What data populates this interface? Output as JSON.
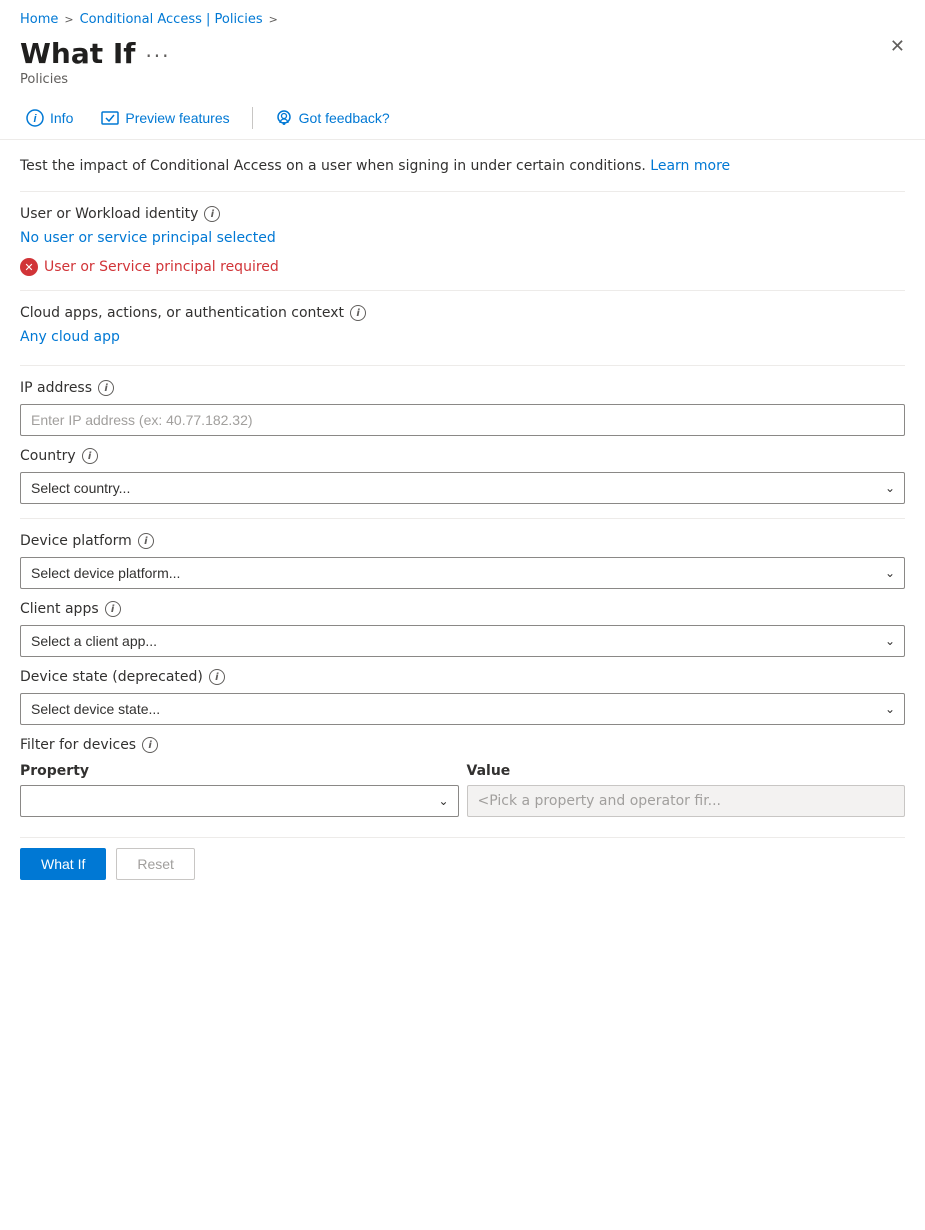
{
  "breadcrumb": {
    "home": "Home",
    "sep1": ">",
    "conditional_access": "Conditional Access | Policies",
    "sep2": ">"
  },
  "header": {
    "title": "What If",
    "more_options_label": "···",
    "subtitle": "Policies",
    "close_label": "✕"
  },
  "toolbar": {
    "info_label": "Info",
    "preview_features_label": "Preview features",
    "feedback_label": "Got feedback?"
  },
  "description": {
    "text": "Test the impact of Conditional Access on a user when signing in under certain conditions.",
    "learn_more": "Learn more"
  },
  "user_identity_section": {
    "label": "User or Workload identity",
    "no_selection_text": "No user or service principal selected",
    "error_text": "User or Service principal required"
  },
  "cloud_apps_section": {
    "label": "Cloud apps, actions, or authentication context",
    "value": "Any cloud app"
  },
  "ip_address_section": {
    "label": "IP address",
    "placeholder": "Enter IP address (ex: 40.77.182.32)"
  },
  "country_section": {
    "label": "Country",
    "placeholder": "Select country..."
  },
  "device_platform_section": {
    "label": "Device platform",
    "placeholder": "Select device platform..."
  },
  "client_apps_section": {
    "label": "Client apps",
    "placeholder": "Select a client app..."
  },
  "device_state_section": {
    "label": "Device state (deprecated)",
    "placeholder": "Select device state..."
  },
  "filter_devices_section": {
    "label": "Filter for devices",
    "property_header": "Property",
    "value_header": "Value",
    "value_placeholder": "<Pick a property and operator fir..."
  },
  "buttons": {
    "what_if": "What If",
    "reset": "Reset"
  }
}
